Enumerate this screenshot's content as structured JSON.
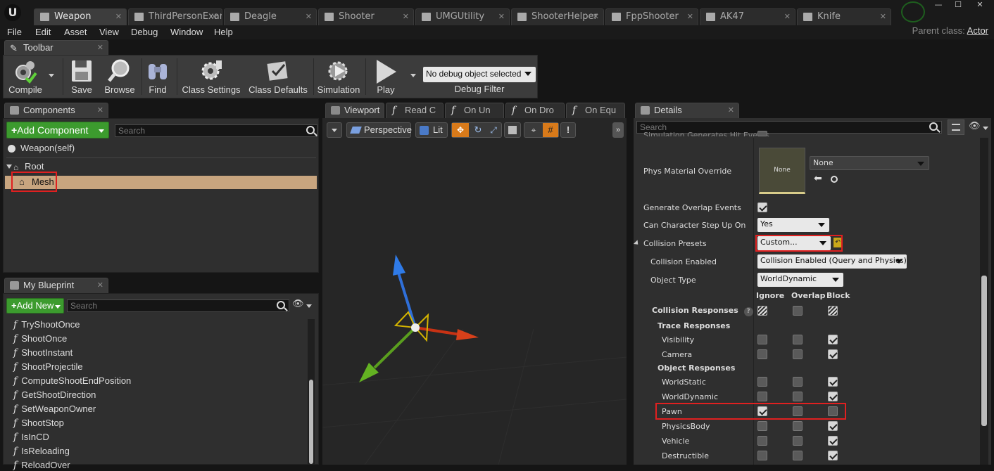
{
  "doc_tabs": [
    {
      "label": "Weapon",
      "active": true
    },
    {
      "label": "ThirdPersonExamp",
      "active": false
    },
    {
      "label": "Deagle",
      "active": false
    },
    {
      "label": "Shooter",
      "active": false
    },
    {
      "label": "UMGUtility",
      "active": false
    },
    {
      "label": "ShooterHelper",
      "active": false
    },
    {
      "label": "FppShooter",
      "active": false
    },
    {
      "label": "AK47",
      "active": false
    },
    {
      "label": "Knife",
      "active": false
    }
  ],
  "menu": [
    "File",
    "Edit",
    "Asset",
    "View",
    "Debug",
    "Window",
    "Help"
  ],
  "parent_class": {
    "label": "Parent class:",
    "value": "Actor"
  },
  "toolbar_tab": "Toolbar",
  "toolbar": {
    "compile": "Compile",
    "save": "Save",
    "browse": "Browse",
    "find": "Find",
    "class_settings": "Class Settings",
    "class_defaults": "Class Defaults",
    "simulation": "Simulation",
    "play": "Play",
    "debug_object": "No debug object selected",
    "debug_filter": "Debug Filter"
  },
  "components": {
    "tab": "Components",
    "add_button": "Add Component",
    "search_placeholder": "Search",
    "self_item": "Weapon(self)",
    "root": "Root",
    "mesh": "Mesh"
  },
  "my_blueprint": {
    "tab": "My Blueprint",
    "add_button": "Add New",
    "search_placeholder": "Search",
    "functions": [
      "TryShootOnce",
      "ShootOnce",
      "ShootInstant",
      "ShootProjectile",
      "ComputeShootEndPosition",
      "GetShootDirection",
      "SetWeaponOwner",
      "ShootStop",
      "IsInCD",
      "IsReloading",
      "ReloadOver"
    ]
  },
  "center_tabs": [
    "Viewport",
    "Read C",
    "On Un",
    "On Dro",
    "On Equ"
  ],
  "viewport": {
    "perspective": "Perspective",
    "lit": "Lit"
  },
  "details": {
    "tab": "Details",
    "search_placeholder": "Search",
    "top_cut": "Simulation Generates Hit Events",
    "phys_material_override": "Phys Material Override",
    "phys_material_thumb": "None",
    "phys_material_value": "None",
    "generate_overlap_events": "Generate Overlap Events",
    "can_character_step_up_on": "Can Character Step Up On",
    "step_up_value": "Yes",
    "collision_presets": "Collision Presets",
    "collision_presets_value": "Custom...",
    "collision_enabled": "Collision Enabled",
    "collision_enabled_value": "Collision Enabled (Query and Physics)",
    "object_type": "Object Type",
    "object_type_value": "WorldDynamic",
    "col_headers": [
      "Ignore",
      "Overlap",
      "Block"
    ],
    "collision_responses": "Collision Responses",
    "trace_responses": "Trace Responses",
    "object_responses": "Object Responses",
    "trace_rows": [
      {
        "name": "Visibility",
        "state": [
          false,
          false,
          true
        ]
      },
      {
        "name": "Camera",
        "state": [
          false,
          false,
          true
        ]
      }
    ],
    "object_rows": [
      {
        "name": "WorldStatic",
        "state": [
          false,
          false,
          true
        ]
      },
      {
        "name": "WorldDynamic",
        "state": [
          false,
          false,
          true
        ]
      },
      {
        "name": "Pawn",
        "state": [
          true,
          false,
          false
        ]
      },
      {
        "name": "PhysicsBody",
        "state": [
          false,
          false,
          true
        ]
      },
      {
        "name": "Vehicle",
        "state": [
          false,
          false,
          true
        ]
      },
      {
        "name": "Destructible",
        "state": [
          false,
          false,
          true
        ]
      }
    ]
  },
  "colors": {
    "accent_green": "#3c9b2e",
    "highlight_red": "#e02020",
    "selection": "#c8a57f"
  }
}
